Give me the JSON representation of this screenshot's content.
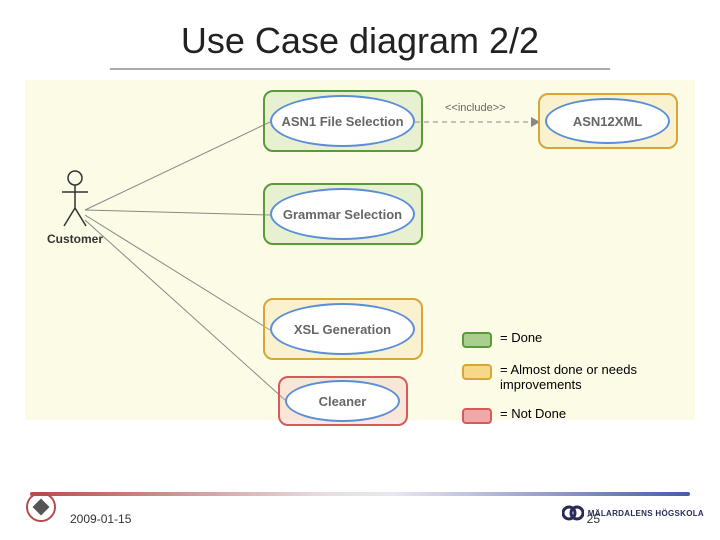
{
  "title": "Use Case diagram 2/2",
  "actor": {
    "label": "Customer"
  },
  "usecases": {
    "asn1file": {
      "label": "ASN1 File Selection"
    },
    "asn12xml": {
      "label": "ASN12XML"
    },
    "grammar": {
      "label": "Grammar Selection"
    },
    "xsl": {
      "label": "XSL Generation"
    },
    "cleaner": {
      "label": "Cleaner"
    }
  },
  "include_label": "<<include>>",
  "legend": {
    "done": {
      "label": "= Done",
      "fill": "#a8cf8e",
      "border": "#5a9a3a"
    },
    "almost": {
      "label": "= Almost done or needs improvements",
      "fill": "#f5d88a",
      "border": "#d6a63a"
    },
    "notdone": {
      "label": "= Not Done",
      "fill": "#f0a8a8",
      "border": "#d65a5a"
    }
  },
  "footer": {
    "date": "2009-01-15",
    "page": "25",
    "right_org": "MÄLARDALENS HÖGSKOLA"
  }
}
